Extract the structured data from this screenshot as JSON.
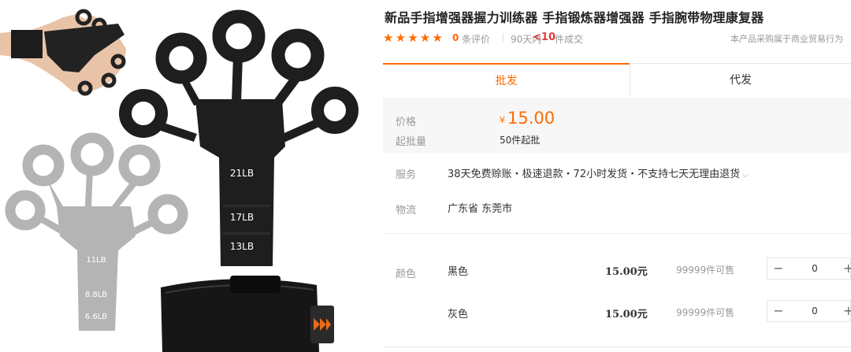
{
  "product": {
    "title": "新品手指增强器握力训练器 手指锻炼器增强器 手指腕带物理康复器",
    "image_labels": {
      "black_band_1": "21LB",
      "black_band_2": "17LB",
      "black_band_3": "13LB",
      "grey_band_1": "11LB",
      "grey_band_2": "8.8LB",
      "grey_band_3": "6.6LB"
    }
  },
  "meta": {
    "stars": 5,
    "review_count": "0",
    "review_label": "条评价",
    "sales_period_label": "90天内",
    "sales_count": "<10",
    "sales_unit": "件成交",
    "business_note": "本产品采购属于商业贸易行为"
  },
  "tabs": [
    {
      "label": "批发",
      "active": true
    },
    {
      "label": "代发",
      "active": false
    }
  ],
  "pricing": {
    "price_label": "价格",
    "currency_symbol": "¥",
    "price": "15.00",
    "moq_label": "起批量",
    "moq_value": "50件起批"
  },
  "service": {
    "label": "服务",
    "value": "38天免费赊账・极速退款・72小时发货・不支持七天无理由退货"
  },
  "logistics": {
    "label": "物流",
    "value": "广东省 东莞市"
  },
  "variants": {
    "label": "颜色",
    "items": [
      {
        "name": "黑色",
        "price": "15.00元",
        "stock": "99999件可售",
        "quantity": "0"
      },
      {
        "name": "灰色",
        "price": "15.00元",
        "stock": "99999件可售",
        "quantity": "0"
      }
    ],
    "minus_symbol": "−",
    "plus_symbol": "+"
  },
  "colors": {
    "accent": "#ff6a00",
    "sales_red": "#e4393c",
    "price_box_bg": "#f7f7f7",
    "device_black": "#1e1e1e",
    "device_grey": "#b4b4b4"
  }
}
